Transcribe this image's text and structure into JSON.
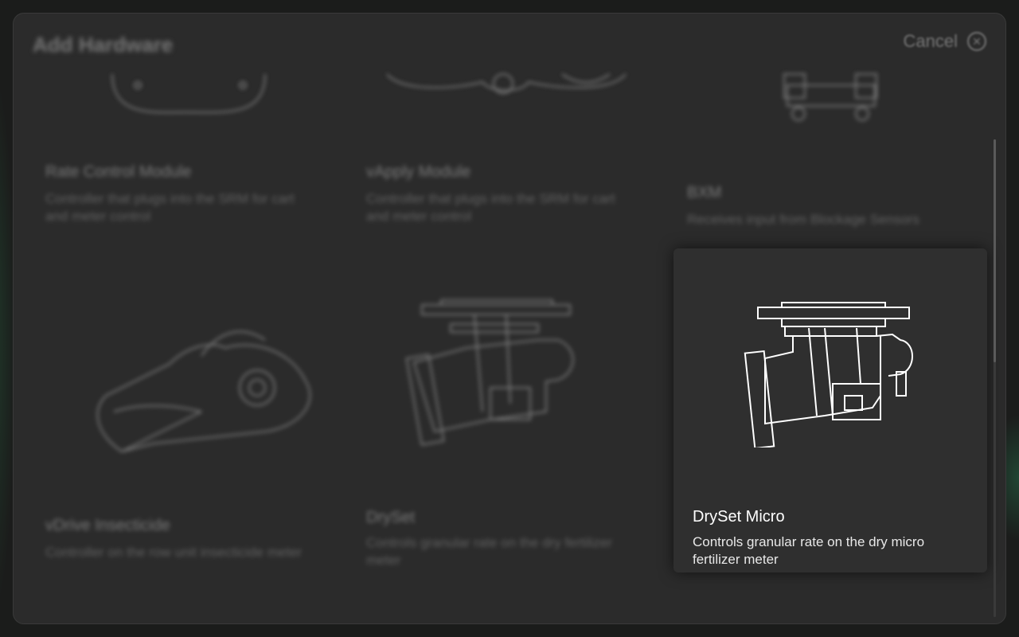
{
  "window": {
    "title": "Add Hardware",
    "cancel_label": "Cancel"
  },
  "hardware": [
    {
      "name": "Rate Control Module",
      "description": "Controller that plugs into the SRM for cart and meter control",
      "icon": "rate-control-module-outline"
    },
    {
      "name": "vApply Module",
      "description": "Controller that plugs into the SRM for cart and meter control",
      "icon": "vapply-module-outline"
    },
    {
      "name": "BXM",
      "description": "Receives input from Blockage Sensors",
      "icon": "bxm-outline"
    },
    {
      "name": "vDrive Insecticide",
      "description": "Controller on the row unit insecticide meter",
      "icon": "vdrive-insecticide-outline"
    },
    {
      "name": "DrySet",
      "description": "Controls granular rate on the dry fertilizer meter",
      "icon": "dryset-outline"
    },
    {
      "name": "DrySet Micro",
      "description": "Controls granular rate on the dry micro fertilizer meter",
      "icon": "dryset-micro-outline",
      "selected": true
    }
  ],
  "colors": {
    "background": "#2b2b2b",
    "selected_card": "#2f2f2f",
    "accent_glow": "#286e46"
  }
}
